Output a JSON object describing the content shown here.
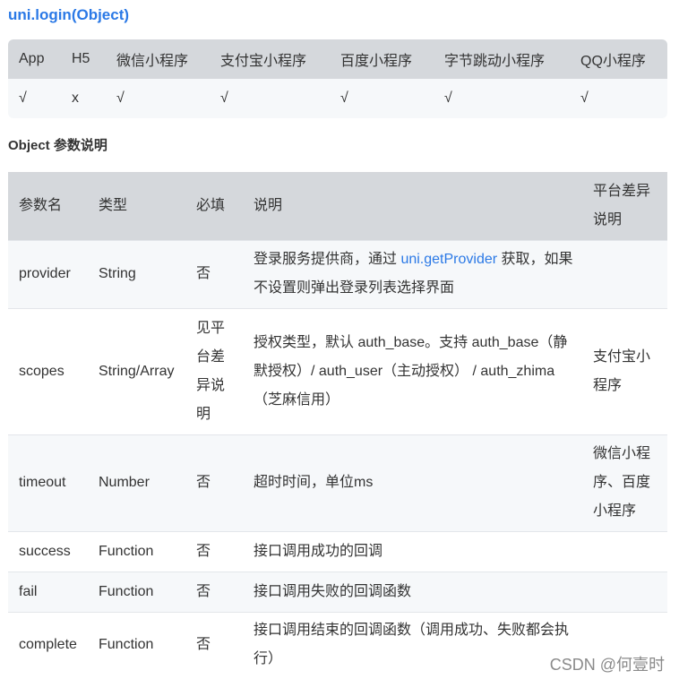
{
  "title": "uni.login(Object)",
  "platform_table": {
    "headers": [
      "App",
      "H5",
      "微信小程序",
      "支付宝小程序",
      "百度小程序",
      "字节跳动小程序",
      "QQ小程序"
    ],
    "values": [
      "√",
      "x",
      "√",
      "√",
      "√",
      "√",
      "√"
    ]
  },
  "params_section_title": "Object 参数说明",
  "params_table": {
    "headers": [
      "参数名",
      "类型",
      "必填",
      "说明",
      "平台差异说明"
    ],
    "rows": [
      {
        "name": "provider",
        "type": "String",
        "required": "否",
        "desc_pre": "登录服务提供商，通过 ",
        "desc_link": "uni.getProvider",
        "desc_post": " 获取，如果不设置则弹出登录列表选择界面",
        "platform": ""
      },
      {
        "name": "scopes",
        "type": "String/Array",
        "required": "见平台差异说明",
        "desc": "授权类型，默认 auth_base。支持 auth_base（静默授权）/ auth_user（主动授权） / auth_zhima（芝麻信用）",
        "platform": "支付宝小程序"
      },
      {
        "name": "timeout",
        "type": "Number",
        "required": "否",
        "desc": "超时时间，单位ms",
        "platform": "微信小程序、百度小程序"
      },
      {
        "name": "success",
        "type": "Function",
        "required": "否",
        "desc": "接口调用成功的回调",
        "platform": ""
      },
      {
        "name": "fail",
        "type": "Function",
        "required": "否",
        "desc": "接口调用失败的回调函数",
        "platform": ""
      },
      {
        "name": "complete",
        "type": "Function",
        "required": "否",
        "desc": "接口调用结束的回调函数（调用成功、失败都会执行）",
        "platform": ""
      }
    ]
  },
  "watermark": "CSDN @何壹时"
}
